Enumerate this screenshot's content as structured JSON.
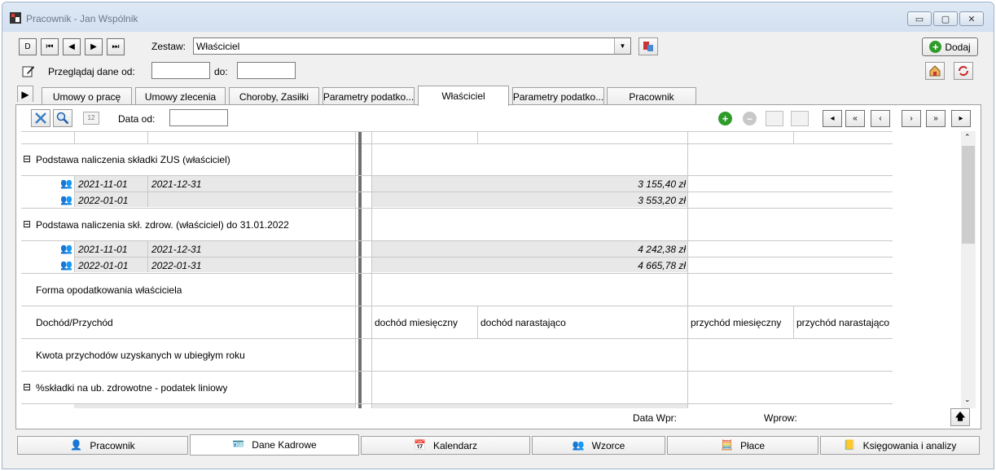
{
  "window": {
    "title": "Pracownik - Jan Wspólnik"
  },
  "toolbar": {
    "zestaw_label": "Zestaw:",
    "zestaw_value": "Właściciel",
    "dodaj_label": "Dodaj",
    "przegladaj_label": "Przeglądaj dane od:",
    "do_label": "do:",
    "od_value": "",
    "do_value": ""
  },
  "tabs": [
    {
      "label": "Umowy o pracę"
    },
    {
      "label": "Umowy zlecenia"
    },
    {
      "label": "Choroby, Zasiłki"
    },
    {
      "label": "Parametry podatko..."
    },
    {
      "label": "Właściciel"
    },
    {
      "label": "Parametry podatko..."
    },
    {
      "label": "Pracownik"
    }
  ],
  "panel": {
    "data_od_label": "Data od:",
    "data_od_value": "",
    "data_wpr_label": "Data Wpr:",
    "wprow_label": "Wprow:"
  },
  "grid": {
    "group1": {
      "title": "Podstawa naliczenia składki ZUS (właściciel)",
      "rows": [
        {
          "from": "2021-11-01",
          "to": "2021-12-31",
          "amount": "3 155,40 zł"
        },
        {
          "from": "2022-01-01",
          "to": "",
          "amount": "3 553,20 zł"
        }
      ]
    },
    "group2": {
      "title": "Podstawa naliczenia skł. zdrow. (właściciel) do 31.01.2022",
      "rows": [
        {
          "from": "2021-11-01",
          "to": "2021-12-31",
          "amount": "4 242,38 zł"
        },
        {
          "from": "2022-01-01",
          "to": "2022-01-31",
          "amount": "4 665,78 zł"
        }
      ]
    },
    "forma": "Forma opodatkowania właściciela",
    "dochod": {
      "label": "Dochód/Przychód",
      "col1": "dochód miesięczny",
      "col2": "dochód narastająco",
      "col3": "przychód miesięczny",
      "col4": "przychód narastająco"
    },
    "kwota": "Kwota przychodów uzyskanych w ubiegłym roku",
    "group3": {
      "title": "%składki na ub. zdrowotne - podatek liniowy"
    }
  },
  "bottom_tabs": [
    {
      "label": "Pracownik"
    },
    {
      "label": "Dane Kadrowe"
    },
    {
      "label": "Kalendarz"
    },
    {
      "label": "Wzorce"
    },
    {
      "label": "Płace"
    },
    {
      "label": "Księgowania i analizy"
    }
  ]
}
